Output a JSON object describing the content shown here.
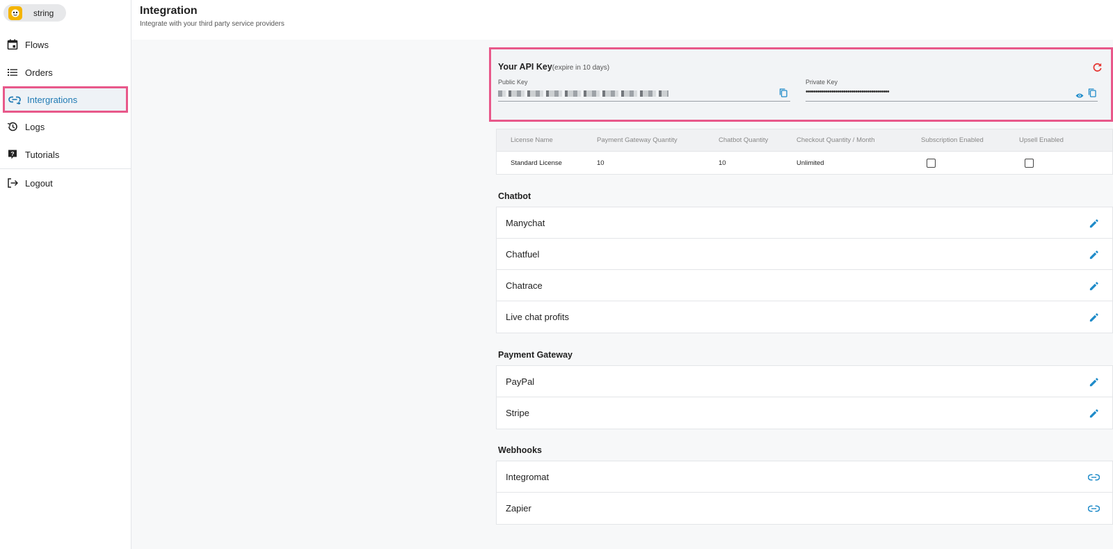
{
  "brand": {
    "name": "string"
  },
  "sidebar": {
    "items": [
      {
        "label": "Flows",
        "icon": "calendar-icon"
      },
      {
        "label": "Orders",
        "icon": "list-icon"
      },
      {
        "label": "Intergrations",
        "icon": "link-icon",
        "active": true
      },
      {
        "label": "Logs",
        "icon": "history-icon"
      },
      {
        "label": "Tutorials",
        "icon": "help-icon"
      },
      {
        "label": "Logout",
        "icon": "logout-icon"
      }
    ]
  },
  "header": {
    "title": "Integration",
    "subtitle": "Integrate with your third party service providers"
  },
  "api_key": {
    "title": "Your API Key",
    "expire": "(expire in 10 days)",
    "public_label": "Public Key",
    "private_label": "Private Key",
    "private_value": "••••••••••••••••••••••••••••••••••••••••••"
  },
  "license": {
    "headers": [
      "License Name",
      "Payment Gateway Quantity",
      "Chatbot Quantity",
      "Checkout Quantity / Month",
      "Subscription Enabled",
      "Upsell Enabled"
    ],
    "row": {
      "name": "Standard License",
      "payment_gateway_qty": "10",
      "chatbot_qty": "10",
      "checkout_qty": "Unlimited",
      "subscription_enabled": false,
      "upsell_enabled": false
    }
  },
  "sections": {
    "chatbot": {
      "title": "Chatbot",
      "items": [
        "Manychat",
        "Chatfuel",
        "Chatrace",
        "Live chat profits"
      ]
    },
    "payment": {
      "title": "Payment Gateway",
      "items": [
        "PayPal",
        "Stripe"
      ]
    },
    "webhooks": {
      "title": "Webhooks",
      "items": [
        "Integromat",
        "Zapier"
      ]
    }
  },
  "colors": {
    "accent": "#1f8bc9",
    "highlight": "#e8588a",
    "refresh": "#e53935"
  }
}
